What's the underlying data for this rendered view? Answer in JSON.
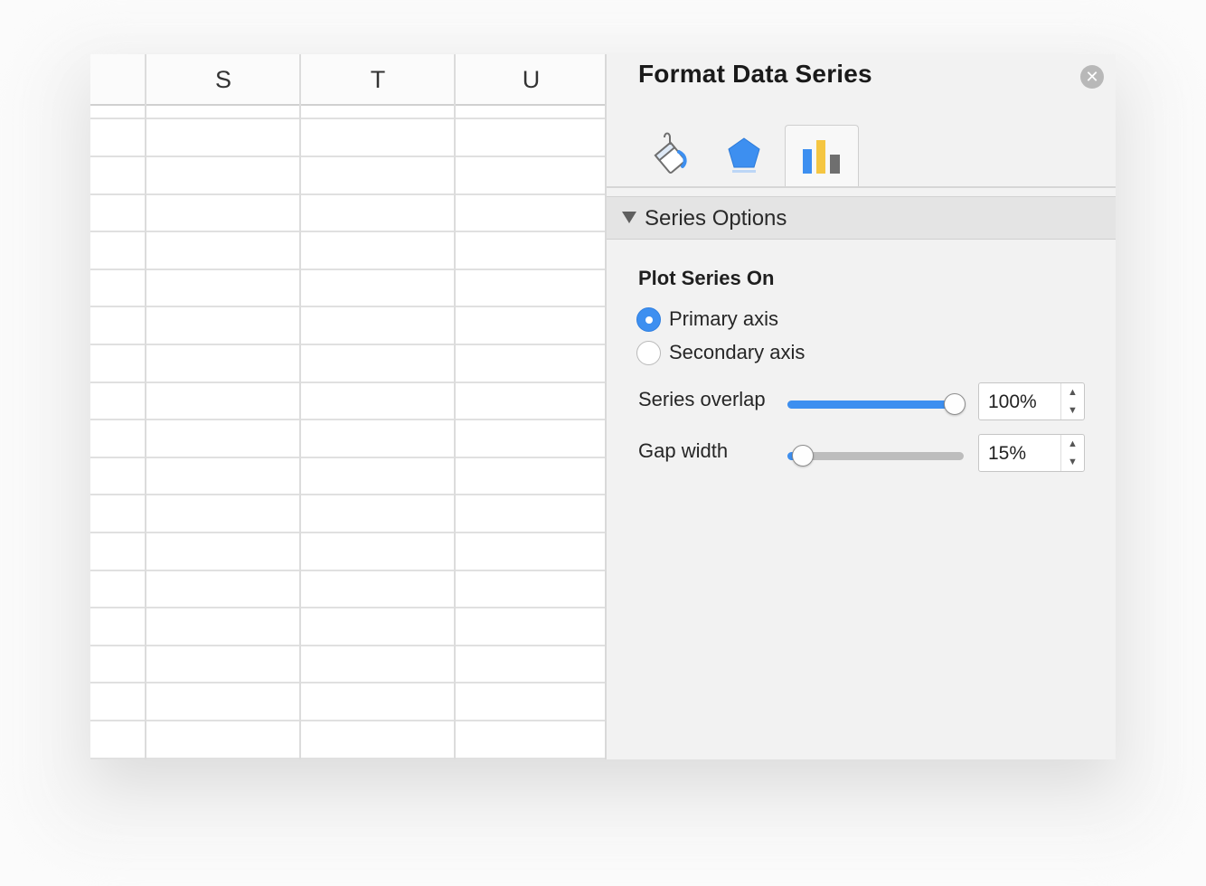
{
  "sheet": {
    "columns": [
      "S",
      "T",
      "U"
    ]
  },
  "pane": {
    "title": "Format Data Series",
    "close_icon": "close-icon",
    "tabs": [
      {
        "icon": "fill-bucket-icon",
        "active": false
      },
      {
        "icon": "pentagon-effects-icon",
        "active": false
      },
      {
        "icon": "bar-chart-icon",
        "active": true
      }
    ],
    "section": {
      "label": "Series Options",
      "expanded": true
    },
    "plot_series_on": {
      "label": "Plot Series On",
      "options": [
        {
          "label": "Primary axis",
          "selected": true
        },
        {
          "label": "Secondary axis",
          "selected": false
        }
      ]
    },
    "series_overlap": {
      "label": "Series overlap",
      "value_text": "100%",
      "level": 1.0
    },
    "gap_width": {
      "label": "Gap width",
      "value_text": "15%",
      "level": 0.03
    }
  },
  "colors": {
    "accent": "#3d8ff0",
    "pane_bg": "#f2f2f2",
    "section_bg": "#e4e4e4",
    "bar_blue": "#3d8ff0",
    "bar_yellow": "#f5c642",
    "bar_gray": "#6f6f6f"
  }
}
